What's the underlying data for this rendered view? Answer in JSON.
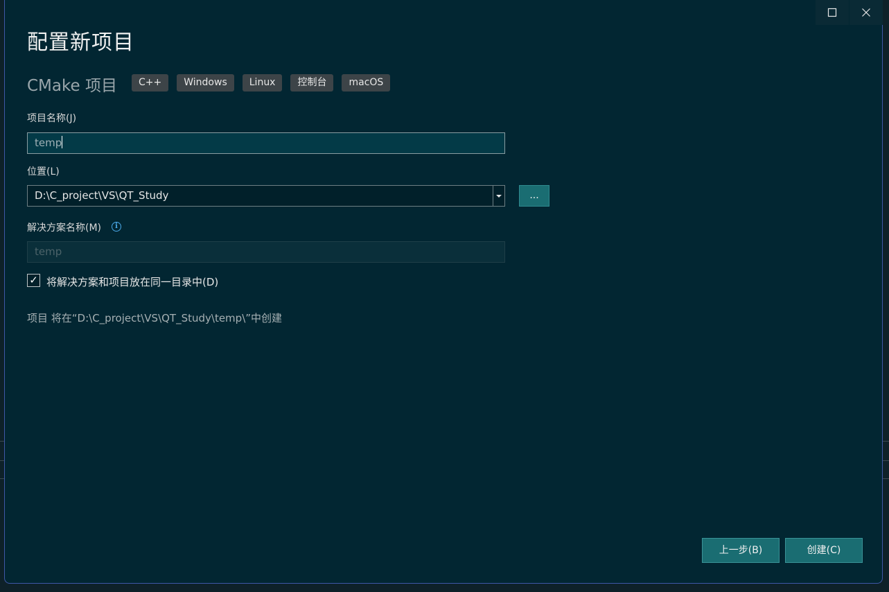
{
  "dialog": {
    "title": "配置新项目",
    "subtitle": "CMake 项目",
    "tags": [
      "C++",
      "Windows",
      "Linux",
      "控制台",
      "macOS"
    ]
  },
  "window_controls": {
    "maximize_icon": "maximize-icon",
    "close_icon": "close-icon"
  },
  "form": {
    "project_name_label": "项目名称(J)",
    "project_name_value": "temp",
    "location_label": "位置(L)",
    "location_value": "D:\\C_project\\VS\\QT_Study",
    "browse_label": "...",
    "solution_name_label": "解决方案名称(M)",
    "solution_name_placeholder": "temp",
    "same_dir_checkbox_label": "将解决方案和项目放在同一目录中(D)",
    "same_dir_checked": true,
    "path_note": "项目 将在“D:\\C_project\\VS\\QT_Study\\temp\\”中创建"
  },
  "footer": {
    "back_label": "上一步(B)",
    "create_label": "创建(C)"
  },
  "colors": {
    "dialog_bg": "#022632",
    "accent_button": "#1a6d72",
    "border_accent": "#3f58a8",
    "info_icon": "#4aa8e8"
  }
}
